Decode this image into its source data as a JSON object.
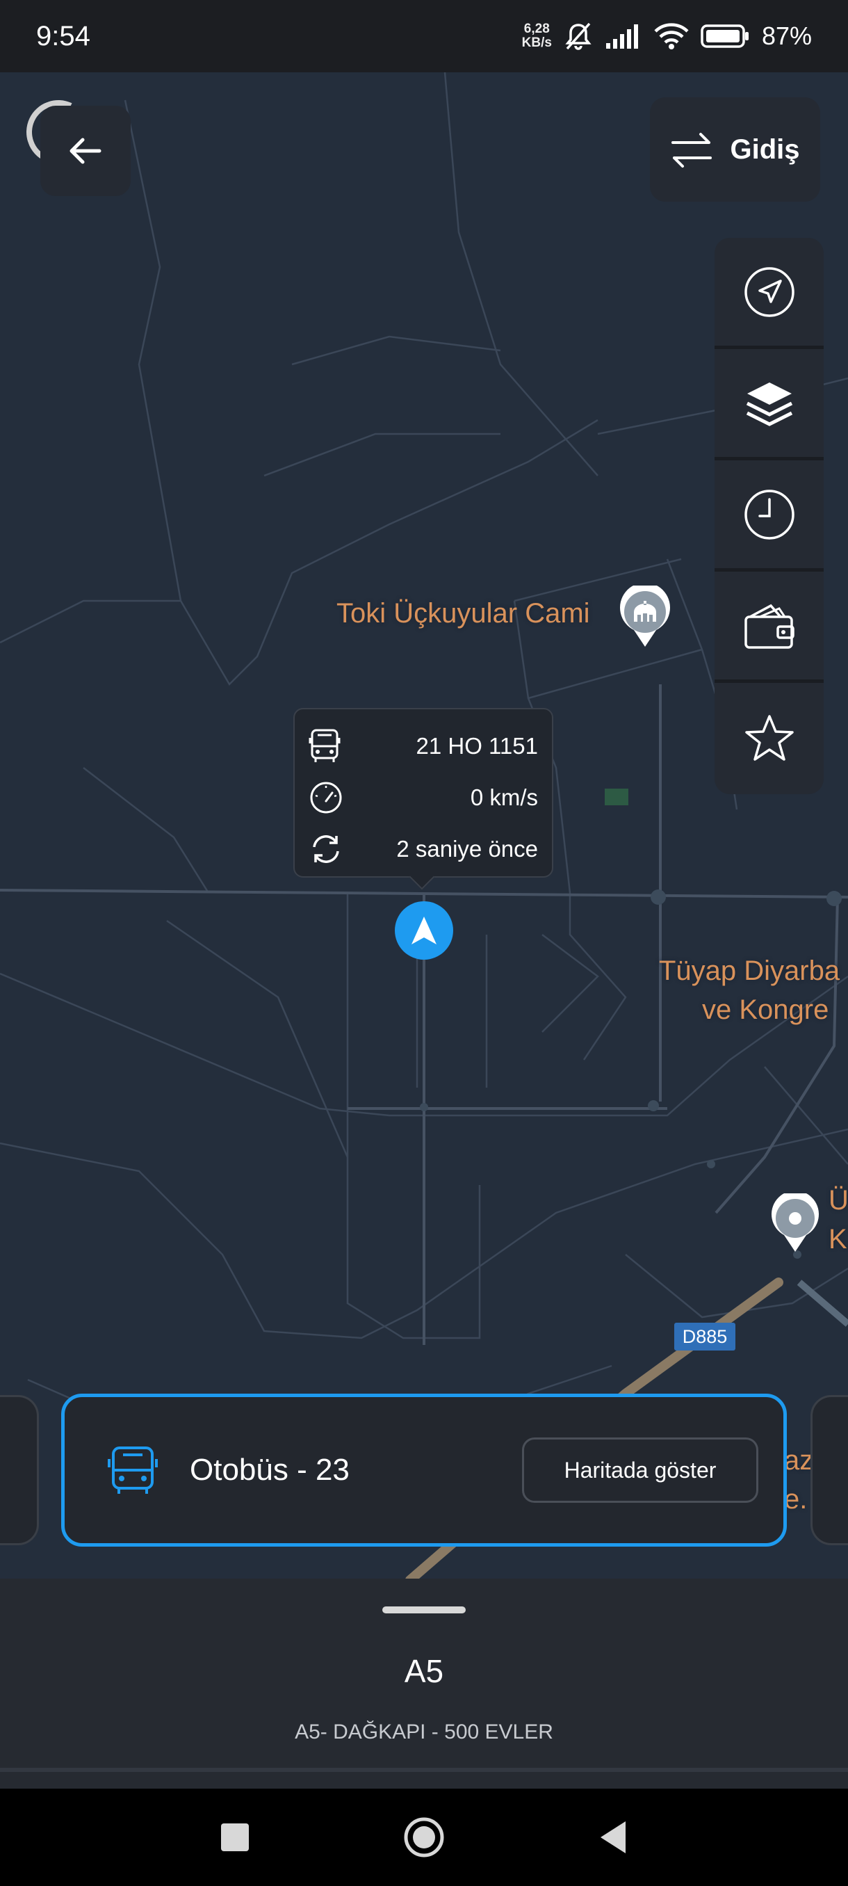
{
  "status_bar": {
    "time": "9:54",
    "net_speed_value": "6,28",
    "net_speed_unit": "KB/s",
    "battery": "87%"
  },
  "header": {
    "route_direction": "Gidiş"
  },
  "map": {
    "poi_mosque": "Toki Üçkuyular Cami",
    "poi_tuyap_line1": "Tüyap Diyarba",
    "poi_tuyap_line2": "ve Kongre",
    "poi_right_line1": "Ü",
    "poi_right_line2": "K",
    "poi_card_right_line1": "az",
    "poi_card_right_line2": "e.",
    "road_badge": "D885"
  },
  "vehicle_popup": {
    "plate": "21 HO 1151",
    "speed": "0 km/s",
    "updated": "2 saniye önce"
  },
  "vehicle_card": {
    "title": "Otobüs - 23",
    "show_on_map": "Haritada göster"
  },
  "bottom_sheet": {
    "line_code": "A5",
    "line_name": "A5- DAĞKAPI - 500 EVLER"
  },
  "icons": {
    "back": "arrow-left-icon",
    "swap": "swap-arrows-icon",
    "locate": "navigation-icon",
    "layers": "layers-icon",
    "schedule": "clock-icon",
    "fare": "wallet-icon",
    "favorite": "star-icon",
    "bus": "bus-icon",
    "speed": "speedometer-icon",
    "refresh": "refresh-icon"
  },
  "colors": {
    "accent": "#1e9bf0",
    "poi_label": "#d9925b",
    "map_bg": "#242e3c"
  }
}
